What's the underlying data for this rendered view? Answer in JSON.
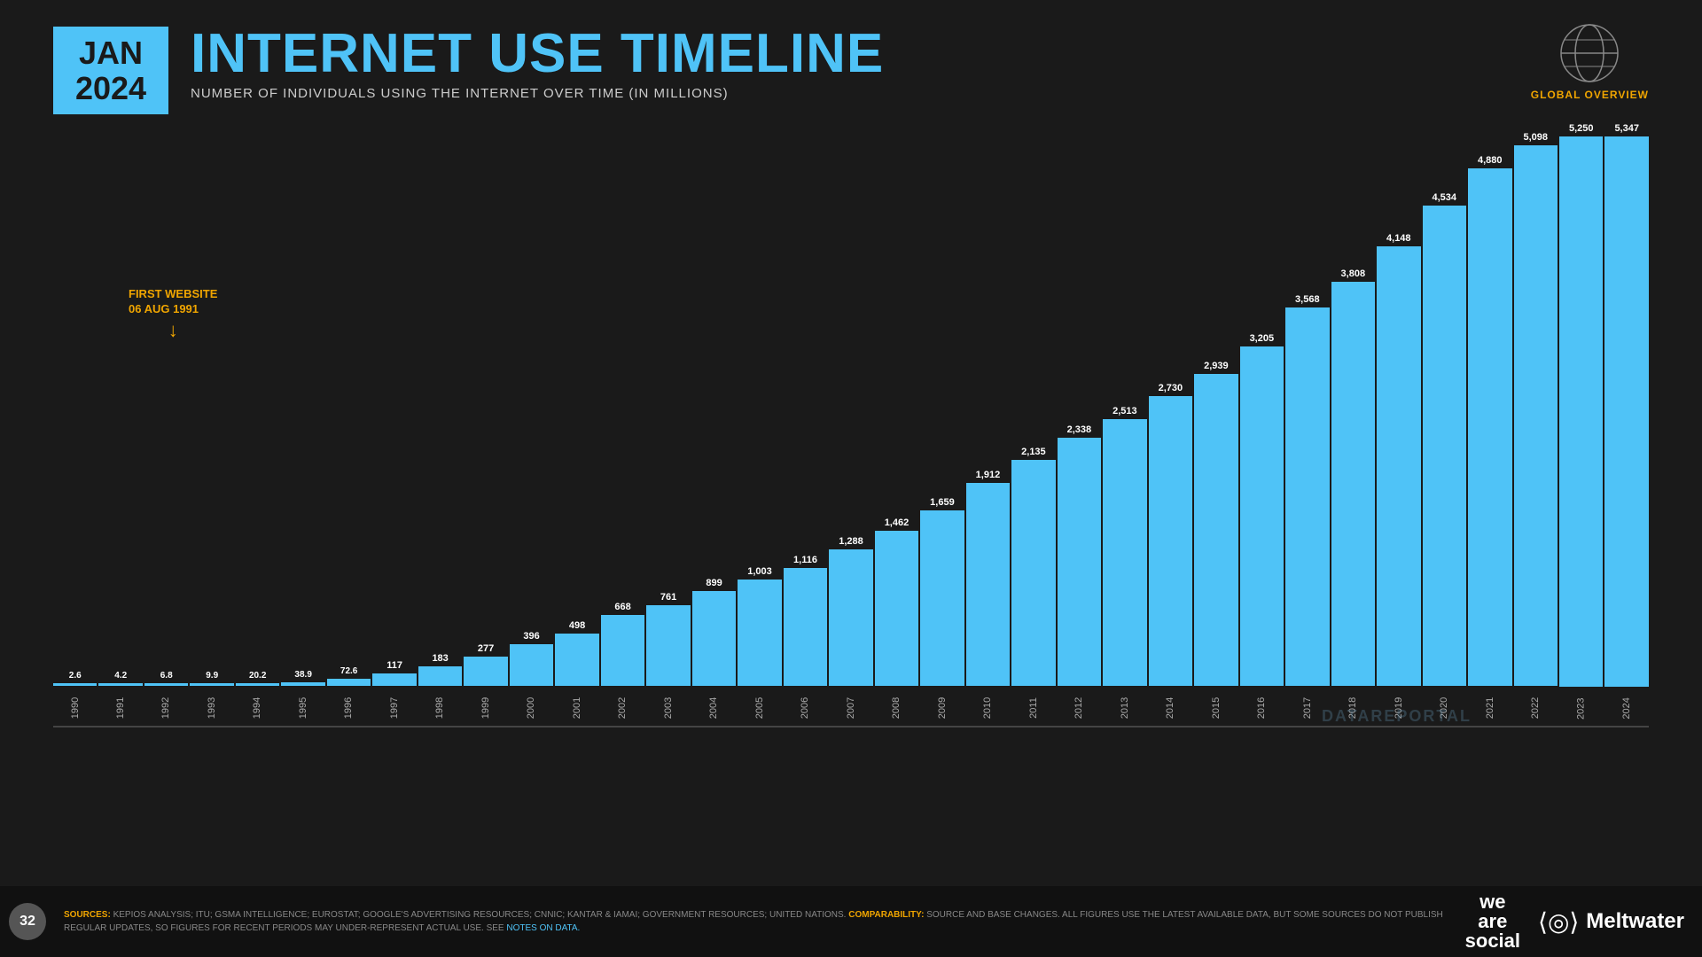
{
  "header": {
    "month": "JAN",
    "year": "2024",
    "title": "INTERNET USE TIMELINE",
    "subtitle": "NUMBER OF INDIVIDUALS USING THE INTERNET OVER TIME (IN MILLIONS)",
    "global_label": "GLOBAL OVERVIEW"
  },
  "annotation": {
    "line1": "FIRST WEBSITE",
    "line2": "06 AUG 1991"
  },
  "watermark": "DATAREPORTAL",
  "bars": [
    {
      "year": "1990",
      "value": 2.6,
      "label": "2.6"
    },
    {
      "year": "1991",
      "value": 4.2,
      "label": "4.2"
    },
    {
      "year": "1992",
      "value": 6.8,
      "label": "6.8"
    },
    {
      "year": "1993",
      "value": 9.9,
      "label": "9.9"
    },
    {
      "year": "1994",
      "value": 20.2,
      "label": "20.2"
    },
    {
      "year": "1995",
      "value": 38.9,
      "label": "38.9"
    },
    {
      "year": "1996",
      "value": 72.6,
      "label": "72.6"
    },
    {
      "year": "1997",
      "value": 117,
      "label": "117"
    },
    {
      "year": "1998",
      "value": 183,
      "label": "183"
    },
    {
      "year": "1999",
      "value": 277,
      "label": "277"
    },
    {
      "year": "2000",
      "value": 396,
      "label": "396"
    },
    {
      "year": "2001",
      "value": 498,
      "label": "498"
    },
    {
      "year": "2002",
      "value": 668,
      "label": "668"
    },
    {
      "year": "2003",
      "value": 761,
      "label": "761"
    },
    {
      "year": "2004",
      "value": 899,
      "label": "899"
    },
    {
      "year": "2005",
      "value": 1003,
      "label": "1,003"
    },
    {
      "year": "2006",
      "value": 1116,
      "label": "1,116"
    },
    {
      "year": "2007",
      "value": 1288,
      "label": "1,288"
    },
    {
      "year": "2008",
      "value": 1462,
      "label": "1,462"
    },
    {
      "year": "2009",
      "value": 1659,
      "label": "1,659"
    },
    {
      "year": "2010",
      "value": 1912,
      "label": "1,912"
    },
    {
      "year": "2011",
      "value": 2135,
      "label": "2,135"
    },
    {
      "year": "2012",
      "value": 2338,
      "label": "2,338"
    },
    {
      "year": "2013",
      "value": 2513,
      "label": "2,513"
    },
    {
      "year": "2014",
      "value": 2730,
      "label": "2,730"
    },
    {
      "year": "2015",
      "value": 2939,
      "label": "2,939"
    },
    {
      "year": "2016",
      "value": 3205,
      "label": "3,205"
    },
    {
      "year": "2017",
      "value": 3568,
      "label": "3,568"
    },
    {
      "year": "2018",
      "value": 3808,
      "label": "3,808"
    },
    {
      "year": "2019",
      "value": 4148,
      "label": "4,148"
    },
    {
      "year": "2020",
      "value": 4534,
      "label": "4,534"
    },
    {
      "year": "2021",
      "value": 4880,
      "label": "4,880"
    },
    {
      "year": "2022",
      "value": 5098,
      "label": "5,098"
    },
    {
      "year": "2023",
      "value": 5250,
      "label": "5,250"
    },
    {
      "year": "2024",
      "value": 5347,
      "label": "5,347"
    }
  ],
  "footer": {
    "page_number": "32",
    "sources_label": "SOURCES:",
    "sources_text": "KEPIOS ANALYSIS; ITU; GSMA INTELLIGENCE; EUROSTAT; GOOGLE'S ADVERTISING RESOURCES; CNNIC; KANTAR & IAMAI; GOVERNMENT RESOURCES; UNITED NATIONS.",
    "comparability_label": "COMPARABILITY:",
    "comparability_text": "SOURCE AND BASE CHANGES. ALL FIGURES USE THE LATEST AVAILABLE DATA, BUT SOME SOURCES DO NOT PUBLISH REGULAR UPDATES, SO FIGURES FOR RECENT PERIODS MAY UNDER-REPRESENT ACTUAL USE. SEE",
    "notes_link": "NOTES ON DATA.",
    "logo_we": "we",
    "logo_are": "are",
    "logo_social": "social",
    "meltwater_text": "Meltwater"
  }
}
